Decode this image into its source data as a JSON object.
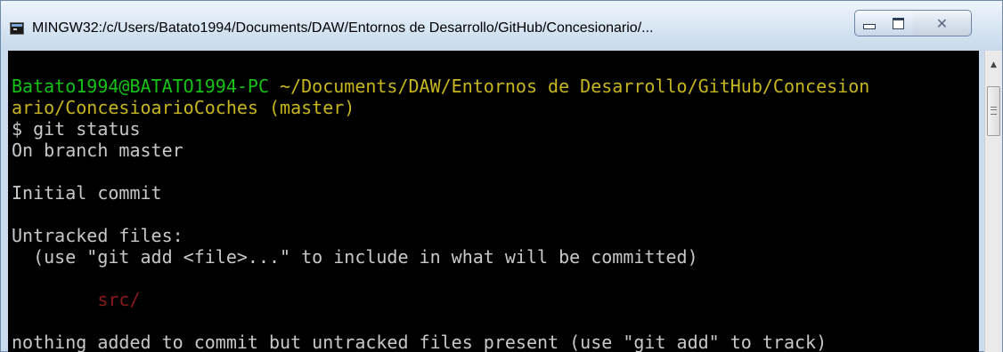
{
  "window": {
    "title": "MINGW32:/c/Users/Batato1994/Documents/DAW/Entornos de Desarrollo/GitHub/Concesionario/..."
  },
  "controls": {
    "minimize_icon": "minimize-icon",
    "maximize_icon": "maximize-icon",
    "close_icon": "close-icon",
    "close_glyph": "✕"
  },
  "terminal": {
    "prompt_user": "Batato1994@BATATO1994-PC",
    "prompt_path_1": " ~/Documents/DAW/Entornos de Desarrollo/GitHub/Concesion",
    "prompt_path_2": "ario/ConcesioarioCoches",
    "prompt_branch": " (master)",
    "command": "$ git status",
    "line_branch": "On branch master",
    "line_initial": "Initial commit",
    "line_untracked": "Untracked files:",
    "line_hint": "  (use \"git add <file>...\" to include in what will be committed)",
    "untracked_file": "src/",
    "line_nothing": "nothing added to commit but untracked files present (use \"git add\" to track)"
  },
  "colors": {
    "terminal_bg": "#000000",
    "user_host": "#15c215",
    "path": "#c7b61e",
    "untracked": "#8b1a1a",
    "text": "#c8c8c8"
  },
  "scrollbar": {
    "up_arrow": "▲"
  }
}
